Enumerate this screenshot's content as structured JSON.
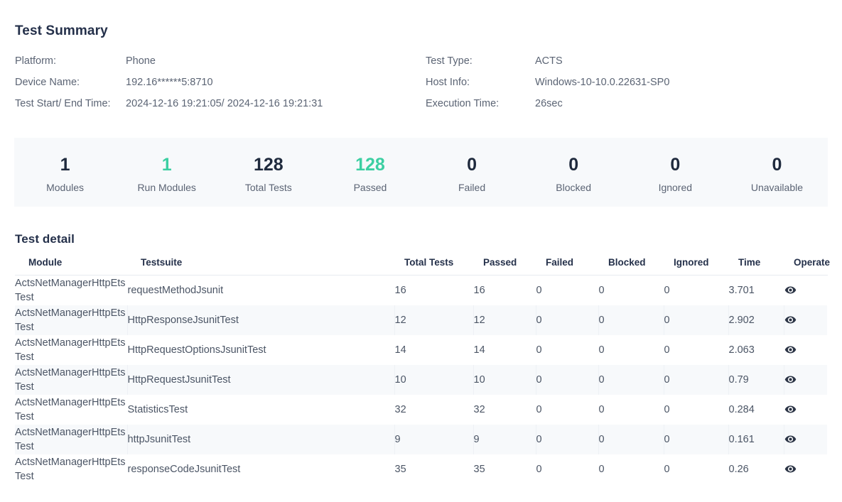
{
  "summary": {
    "title": "Test Summary",
    "fields": [
      {
        "label": "Platform:",
        "value": "Phone"
      },
      {
        "label": "Test Type:",
        "value": "ACTS"
      },
      {
        "label": "Device Name:",
        "value": "192.16******5:8710"
      },
      {
        "label": "Host Info:",
        "value": "Windows-10-10.0.22631-SP0"
      },
      {
        "label": "Test Start/ End Time:",
        "value": "2024-12-16 19:21:05/ 2024-12-16 19:21:31"
      },
      {
        "label": "Execution Time:",
        "value": "26sec"
      }
    ],
    "stats": [
      {
        "value": "1",
        "label": "Modules",
        "accent": false
      },
      {
        "value": "1",
        "label": "Run Modules",
        "accent": true
      },
      {
        "value": "128",
        "label": "Total Tests",
        "accent": false
      },
      {
        "value": "128",
        "label": "Passed",
        "accent": true
      },
      {
        "value": "0",
        "label": "Failed",
        "accent": false
      },
      {
        "value": "0",
        "label": "Blocked",
        "accent": false
      },
      {
        "value": "0",
        "label": "Ignored",
        "accent": false
      },
      {
        "value": "0",
        "label": "Unavailable",
        "accent": false
      }
    ],
    "accent_color": "#3ccfa2"
  },
  "detail": {
    "title": "Test detail",
    "columns": [
      "Module",
      "Testsuite",
      "Total Tests",
      "Passed",
      "Failed",
      "Blocked",
      "Ignored",
      "Time",
      "Operate"
    ],
    "operate_icon": "eye-icon",
    "rows": [
      {
        "module": "ActsNetManagerHttpEtsTest",
        "testsuite": "requestMethodJsunit",
        "total": "16",
        "passed": "16",
        "failed": "0",
        "blocked": "0",
        "ignored": "0",
        "time": "3.701"
      },
      {
        "module": "ActsNetManagerHttpEtsTest",
        "testsuite": "HttpResponseJsunitTest",
        "total": "12",
        "passed": "12",
        "failed": "0",
        "blocked": "0",
        "ignored": "0",
        "time": "2.902"
      },
      {
        "module": "ActsNetManagerHttpEtsTest",
        "testsuite": "HttpRequestOptionsJsunitTest",
        "total": "14",
        "passed": "14",
        "failed": "0",
        "blocked": "0",
        "ignored": "0",
        "time": "2.063"
      },
      {
        "module": "ActsNetManagerHttpEtsTest",
        "testsuite": "HttpRequestJsunitTest",
        "total": "10",
        "passed": "10",
        "failed": "0",
        "blocked": "0",
        "ignored": "0",
        "time": "0.79"
      },
      {
        "module": "ActsNetManagerHttpEtsTest",
        "testsuite": "StatisticsTest",
        "total": "32",
        "passed": "32",
        "failed": "0",
        "blocked": "0",
        "ignored": "0",
        "time": "0.284"
      },
      {
        "module": "ActsNetManagerHttpEtsTest",
        "testsuite": "httpJsunitTest",
        "total": "9",
        "passed": "9",
        "failed": "0",
        "blocked": "0",
        "ignored": "0",
        "time": "0.161"
      },
      {
        "module": "ActsNetManagerHttpEtsTest",
        "testsuite": "responseCodeJsunitTest",
        "total": "35",
        "passed": "35",
        "failed": "0",
        "blocked": "0",
        "ignored": "0",
        "time": "0.26"
      }
    ]
  }
}
